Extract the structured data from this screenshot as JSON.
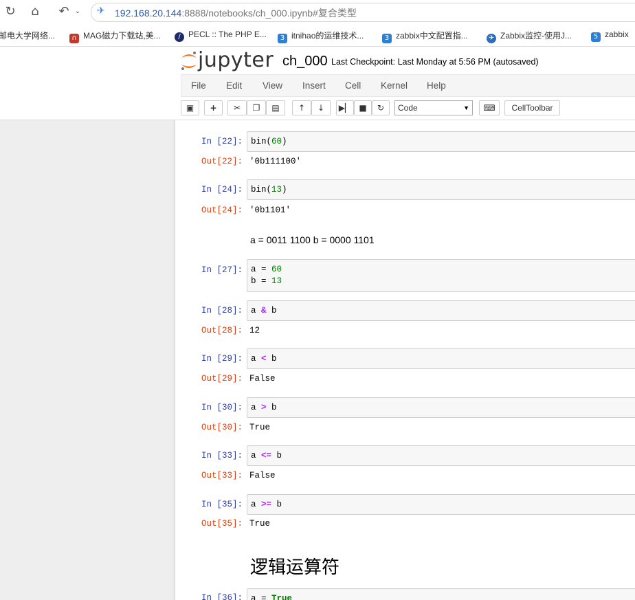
{
  "browser": {
    "url_host": "192.168.20.144",
    "url_path": ":8888/notebooks/ch_000.ipynb#复合类型",
    "bookmarks": [
      {
        "label": "邮电大学网络...",
        "icon": "globe-icon",
        "color": "#8a8a8a"
      },
      {
        "label": "MAG磁力下载站,美...",
        "icon": "magnet-icon",
        "color": "#c0392b"
      },
      {
        "label": "PECL :: The PHP E...",
        "icon": "php-icon",
        "color": "#1d2b6b"
      },
      {
        "label": "itnihao的运维技术...",
        "icon": "three-icon",
        "color": "#2e7fd1"
      },
      {
        "label": "zabbix中文配置指...",
        "icon": "three-icon",
        "color": "#2e7fd1"
      },
      {
        "label": "Zabbix监控-使用J...",
        "icon": "bird-icon",
        "color": "#2a6fb8"
      },
      {
        "label": "zabbix",
        "icon": "five-icon",
        "color": "#2e7fd1"
      }
    ]
  },
  "jupyter": {
    "logo_text": "jupyter",
    "notebook_name": "ch_000",
    "checkpoint": "Last Checkpoint: Last Monday at 5:56 PM (autosaved)",
    "menu": [
      "File",
      "Edit",
      "View",
      "Insert",
      "Cell",
      "Kernel",
      "Help"
    ],
    "celltype": "Code",
    "celltoolbar": "CellToolbar"
  },
  "cells": [
    {
      "in": "In [22]:",
      "code": "bin(60)",
      "out": "Out[22]:",
      "result": "'0b111100'"
    },
    {
      "in": "In [24]:",
      "code": "bin(13)",
      "out": "Out[24]:",
      "result": "'0b1101'"
    },
    {
      "markdown": "a = 0011 1100 b = 0000 1101"
    },
    {
      "in": "In [27]:",
      "code_line1": "a = 60",
      "code_line2": "b = 13"
    },
    {
      "in": "In [28]:",
      "code": "a & b",
      "out": "Out[28]:",
      "result": "12"
    },
    {
      "in": "In [29]:",
      "code": "a < b",
      "out": "Out[29]:",
      "result": "False"
    },
    {
      "in": "In [30]:",
      "code": "a > b",
      "out": "Out[30]:",
      "result": "True"
    },
    {
      "in": "In [33]:",
      "code": "a <= b",
      "out": "Out[33]:",
      "result": "False"
    },
    {
      "in": "In [35]:",
      "code": "a >= b",
      "out": "Out[35]:",
      "result": "True"
    },
    {
      "heading": "逻辑运算符"
    },
    {
      "in": "In [36]:",
      "code": "a = True"
    }
  ]
}
